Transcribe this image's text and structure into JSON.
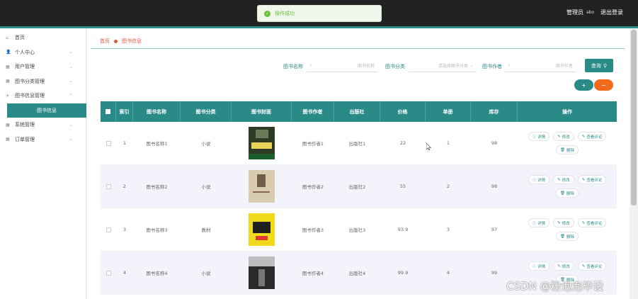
{
  "topbar": {
    "admin_label": "管理员",
    "username": "abo",
    "logout": "退出登录"
  },
  "toast": {
    "message": "操作成功"
  },
  "sidebar": {
    "items": [
      {
        "label": "首页",
        "icon": "home-icon",
        "arrow": false
      },
      {
        "label": "个人中心",
        "icon": "user-icon",
        "arrow": true
      },
      {
        "label": "用户管理",
        "icon": "grid-icon",
        "arrow": true
      },
      {
        "label": "图书分类管理",
        "icon": "grid-icon",
        "arrow": true
      },
      {
        "label": "图书信息管理",
        "icon": "send-icon",
        "arrow": true
      },
      {
        "label": "图书信息",
        "icon": "",
        "arrow": false,
        "active": true
      },
      {
        "label": "系统管理",
        "icon": "grid-icon",
        "arrow": true
      },
      {
        "label": "订单管理",
        "icon": "grid-icon",
        "arrow": true
      }
    ]
  },
  "breadcrumb": {
    "home": "首页",
    "current": "图书信息"
  },
  "search": {
    "name_label": "图书名称",
    "name_placeholder": "图书名称",
    "category_label": "图书分类",
    "category_placeholder": "请选择图书分类",
    "author_label": "图书作者",
    "author_placeholder": "图书作者",
    "button": "查询"
  },
  "actions": {
    "add": "+",
    "delete": "−"
  },
  "table": {
    "headers": [
      "索引",
      "图书名称",
      "图书分类",
      "图书封面",
      "图书作者",
      "出版社",
      "价格",
      "单册",
      "库存",
      "操作"
    ],
    "rows": [
      {
        "index": "1",
        "name": "图书名称1",
        "category": "小说",
        "author": "图书作者1",
        "publisher": "出版社1",
        "price": "22",
        "count": "1",
        "stock": "98"
      },
      {
        "index": "2",
        "name": "图书名称2",
        "category": "小说",
        "author": "图书作者2",
        "publisher": "出版社2",
        "price": "55",
        "count": "2",
        "stock": "98"
      },
      {
        "index": "3",
        "name": "图书名称3",
        "category": "教材",
        "author": "图书作者3",
        "publisher": "出版社3",
        "price": "93.9",
        "count": "3",
        "stock": "97"
      },
      {
        "index": "4",
        "name": "图书名称4",
        "category": "小说",
        "author": "图书作者4",
        "publisher": "出版社4",
        "price": "99.9",
        "count": "4",
        "stock": "99"
      }
    ],
    "ops": {
      "detail": "详情",
      "edit": "修改",
      "comments": "查看评论",
      "delete": "删除"
    }
  },
  "watermark": "CSDN @粉泡泡毕设",
  "colors": {
    "accent": "#2a8a88",
    "danger": "#f26b1d",
    "topbar": "#222222",
    "success": "#67c23a"
  }
}
